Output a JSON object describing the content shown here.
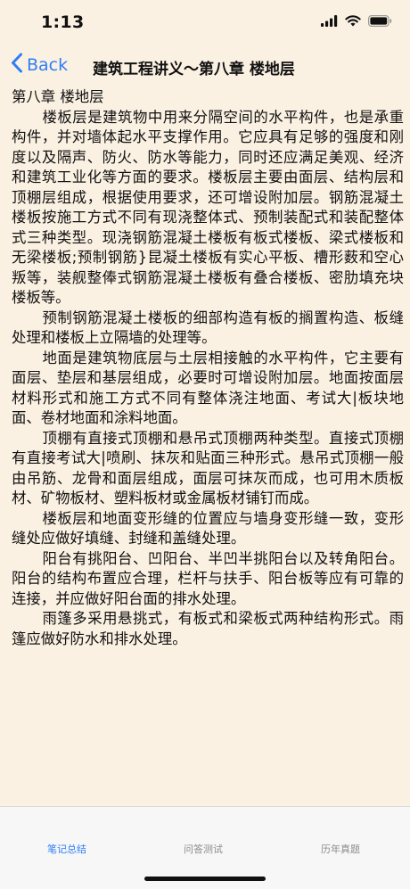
{
  "status": {
    "time": "1:13"
  },
  "nav": {
    "back_label": "Back",
    "title": "建筑工程讲义～第八章 楼地层"
  },
  "content": {
    "chapter": "第八章 楼地层",
    "paragraphs": [
      "楼板层是建筑物中用来分隔空间的水平构件，也是承重构件，并对墙体起水平支撑作用。它应具有足够的强度和刚度以及隔声、防火、防水等能力，同时还应满足美观、经济和建筑工业化等方面的要求。楼板层主要由面层、结构层和顶棚层组成，根据使用要求，还可增设附加层。钢筋混凝土楼板按施工方式不同有现浇整体式、预制装配式和装配整体式三种类型。现浇钢筋混凝土楼板有板式楼板、梁式楼板和无梁楼板;预制钢筋}昆凝土楼板有实心平板、槽形薮和空心叛等，装舰整俸式钢筋混凝土楼板有叠合楼板、密肋填充块楼板等。",
      "预制钢筋混凝土楼板的细部构造有板的搁置构造、板缝处理和楼板上立隔墙的处理等。",
      "地面是建筑物底层与土层相接触的水平构件，它主要有面层、垫层和基层组成，必要时可增设附加层。地面按面层材料形式和施工方式不同有整体浇注地面、考试大|板块地面、卷材地面和涂料地面。",
      "顶棚有直接式顶棚和悬吊式顶棚两种类型。直接式顶棚有直接考试大|喷刷、抹灰和贴面三种形式。悬吊式顶棚一般由吊筋、龙骨和面层组成，面层可抹灰而成，也可用木质板材、矿物板材、塑料板材或金属板材铺钉而成。",
      "楼板层和地面变形缝的位置应与墙身变形缝一致，变形缝处应做好填缝、封缝和盖缝处理。",
      "阳台有挑阳台、凹阳台、半凹半挑阳台以及转角阳台。阳台的结构布置应合理，栏杆与扶手、阳台板等应有可靠的连接，并应做好阳台面的排水处理。",
      "雨篷多采用悬挑式，有板式和梁板式两种结构形式。雨篷应做好防水和排水处理。"
    ]
  },
  "tabs": [
    {
      "label": "笔记总结",
      "active": true
    },
    {
      "label": "问答测试",
      "active": false
    },
    {
      "label": "历年真题",
      "active": false
    }
  ],
  "colors": {
    "accent": "#2f7ef6",
    "background": "#fbf1e3",
    "tabbar": "#f7f7f7",
    "inactive_tab": "#8b8b8b"
  }
}
